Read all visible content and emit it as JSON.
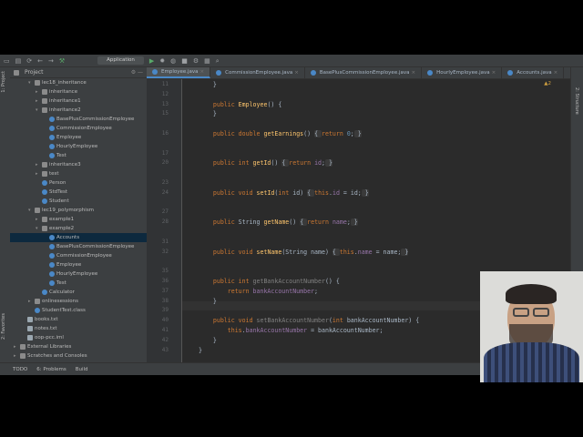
{
  "toolbar": {
    "run_config": "Application"
  },
  "sidebar": {
    "left_tabs": [
      "1: Project",
      "2: Favorites"
    ],
    "right_tabs": [
      "2: Structure"
    ]
  },
  "project_panel": {
    "title": "Project",
    "items": [
      {
        "label": "lec18_inheritance",
        "kind": "folder",
        "depth": 2,
        "open": true
      },
      {
        "label": "inheritance",
        "kind": "folder",
        "depth": 3,
        "open": false
      },
      {
        "label": "inheritance1",
        "kind": "folder",
        "depth": 3,
        "open": false
      },
      {
        "label": "inheritance2",
        "kind": "folder",
        "depth": 3,
        "open": true
      },
      {
        "label": "BasePlusCommissionEmployee",
        "kind": "class",
        "depth": 4
      },
      {
        "label": "CommissionEmployee",
        "kind": "class",
        "depth": 4
      },
      {
        "label": "Employee",
        "kind": "class",
        "depth": 4
      },
      {
        "label": "HourlyEmployee",
        "kind": "class",
        "depth": 4
      },
      {
        "label": "Test",
        "kind": "class",
        "depth": 4
      },
      {
        "label": "inheritance3",
        "kind": "folder",
        "depth": 3,
        "open": false
      },
      {
        "label": "test",
        "kind": "folder",
        "depth": 3,
        "open": false
      },
      {
        "label": "Person",
        "kind": "class",
        "depth": 3
      },
      {
        "label": "StdTest",
        "kind": "class",
        "depth": 3
      },
      {
        "label": "Student",
        "kind": "class",
        "depth": 3
      },
      {
        "label": "lec19_polymorphism",
        "kind": "folder",
        "depth": 2,
        "open": true
      },
      {
        "label": "example1",
        "kind": "folder",
        "depth": 3,
        "open": false
      },
      {
        "label": "example2",
        "kind": "folder",
        "depth": 3,
        "open": true
      },
      {
        "label": "Accounts",
        "kind": "class",
        "depth": 4,
        "selected": true
      },
      {
        "label": "BasePlusCommissionEmployee",
        "kind": "class",
        "depth": 4
      },
      {
        "label": "CommissionEmployee",
        "kind": "class",
        "depth": 4
      },
      {
        "label": "Employee",
        "kind": "class",
        "depth": 4
      },
      {
        "label": "HourlyEmployee",
        "kind": "class",
        "depth": 4
      },
      {
        "label": "Test",
        "kind": "class",
        "depth": 4
      },
      {
        "label": "Calculator",
        "kind": "class",
        "depth": 3
      },
      {
        "label": "onlinesessions",
        "kind": "folder",
        "depth": 2,
        "open": false
      },
      {
        "label": "StudentTest.class",
        "kind": "class",
        "depth": 2
      },
      {
        "label": "books.txt",
        "kind": "file",
        "depth": 1
      },
      {
        "label": "notes.txt",
        "kind": "file",
        "depth": 1
      },
      {
        "label": "oop-pcc.iml",
        "kind": "file",
        "depth": 1
      },
      {
        "label": "External Libraries",
        "kind": "folder",
        "depth": 0,
        "open": false
      },
      {
        "label": "Scratches and Consoles",
        "kind": "folder",
        "depth": 0,
        "open": false
      }
    ]
  },
  "editor": {
    "tabs": [
      {
        "label": "Employee.java",
        "active": true
      },
      {
        "label": "CommissionEmployee.java",
        "active": false
      },
      {
        "label": "BasePlusCommissionEmployee.java",
        "active": false
      },
      {
        "label": "HourlyEmployee.java",
        "active": false
      },
      {
        "label": "Accounts.java",
        "active": false
      }
    ],
    "warnings": "▲2",
    "lines": [
      {
        "num": "11",
        "tokens": [
          [
            "p",
            "    }"
          ]
        ]
      },
      {
        "num": "12",
        "tokens": []
      },
      {
        "num": "13",
        "tokens": [
          [
            "k",
            "    public "
          ],
          [
            "f",
            "Employee"
          ],
          [
            "p",
            "() {"
          ]
        ]
      },
      {
        "num": "15",
        "tokens": [
          [
            "p",
            "    }"
          ]
        ]
      },
      {
        "num": "",
        "tokens": []
      },
      {
        "num": "16",
        "tokens": [
          [
            "k",
            "    public double "
          ],
          [
            "f",
            "getEarnings"
          ],
          [
            "p",
            "() "
          ],
          [
            "o",
            "{ "
          ],
          [
            "k",
            "return "
          ],
          [
            "n",
            "0"
          ],
          [
            "p",
            ";"
          ],
          [
            "o",
            " }"
          ]
        ]
      },
      {
        "num": "",
        "tokens": []
      },
      {
        "num": "17",
        "tokens": []
      },
      {
        "num": "20",
        "tokens": [
          [
            "k",
            "    public int "
          ],
          [
            "f",
            "getId"
          ],
          [
            "p",
            "() "
          ],
          [
            "o",
            "{ "
          ],
          [
            "k",
            "return "
          ],
          [
            "v",
            "id"
          ],
          [
            "p",
            ";"
          ],
          [
            "o",
            " }"
          ]
        ]
      },
      {
        "num": "",
        "tokens": []
      },
      {
        "num": "23",
        "tokens": []
      },
      {
        "num": "24",
        "tokens": [
          [
            "k",
            "    public void "
          ],
          [
            "f",
            "setId"
          ],
          [
            "p",
            "("
          ],
          [
            "k",
            "int "
          ],
          [
            "p",
            "id) "
          ],
          [
            "o",
            "{ "
          ],
          [
            "k",
            "this"
          ],
          [
            "p",
            "."
          ],
          [
            "v",
            "id"
          ],
          [
            "p",
            " = id;"
          ],
          [
            "o",
            " }"
          ]
        ]
      },
      {
        "num": "",
        "tokens": []
      },
      {
        "num": "27",
        "tokens": []
      },
      {
        "num": "28",
        "tokens": [
          [
            "k",
            "    public "
          ],
          [
            "p",
            "String "
          ],
          [
            "f",
            "getName"
          ],
          [
            "p",
            "() "
          ],
          [
            "o",
            "{ "
          ],
          [
            "k",
            "return "
          ],
          [
            "v",
            "name"
          ],
          [
            "p",
            ";"
          ],
          [
            "o",
            " }"
          ]
        ]
      },
      {
        "num": "",
        "tokens": []
      },
      {
        "num": "31",
        "tokens": []
      },
      {
        "num": "32",
        "tokens": [
          [
            "k",
            "    public void "
          ],
          [
            "f",
            "setName"
          ],
          [
            "p",
            "(String name) "
          ],
          [
            "o",
            "{ "
          ],
          [
            "k",
            "this"
          ],
          [
            "p",
            "."
          ],
          [
            "v",
            "name"
          ],
          [
            "p",
            " = name;"
          ],
          [
            "o",
            " }"
          ]
        ]
      },
      {
        "num": "",
        "tokens": []
      },
      {
        "num": "35",
        "tokens": []
      },
      {
        "num": "36",
        "tokens": [
          [
            "k",
            "    public int "
          ],
          [
            "u",
            "getBankAccountNumber"
          ],
          [
            "p",
            "() {"
          ]
        ]
      },
      {
        "num": "37",
        "tokens": [
          [
            "k",
            "        return "
          ],
          [
            "v",
            "bankAccountNumber"
          ],
          [
            "p",
            ";"
          ]
        ]
      },
      {
        "num": "38",
        "tokens": [
          [
            "p",
            "    }"
          ]
        ]
      },
      {
        "num": "39",
        "tokens": []
      },
      {
        "num": "40",
        "tokens": [
          [
            "k",
            "    public void "
          ],
          [
            "u",
            "setBankAccountNumber"
          ],
          [
            "p",
            "("
          ],
          [
            "k",
            "int "
          ],
          [
            "p",
            "bankAccountNumber) {"
          ]
        ]
      },
      {
        "num": "41",
        "tokens": [
          [
            "k",
            "        this"
          ],
          [
            "p",
            "."
          ],
          [
            "v",
            "bankAccountNumber"
          ],
          [
            "p",
            " = bankAccountNumber;"
          ]
        ]
      },
      {
        "num": "42",
        "tokens": [
          [
            "p",
            "    }"
          ]
        ]
      },
      {
        "num": "43",
        "tokens": [
          [
            "p",
            "}"
          ]
        ]
      }
    ]
  },
  "statusbar": {
    "items": [
      "TODO",
      "6: Problems",
      "Build"
    ]
  },
  "colors": {
    "background": "#2b2b2b",
    "keyword": "#cc7832",
    "method": "#ffc66d",
    "field": "#9876aa",
    "number": "#6897bb",
    "selection": "#0d293e"
  }
}
